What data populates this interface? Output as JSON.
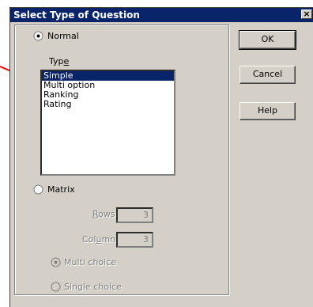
{
  "dialog": {
    "title": "Select Type of Question",
    "close_label": "×"
  },
  "normal": {
    "label": "Normal",
    "selected": true
  },
  "type": {
    "label_prefix": "Typ",
    "label_underline": "e",
    "items": [
      "Simple",
      "Multi option",
      "Ranking",
      "Rating"
    ],
    "selected": "Simple"
  },
  "matrix": {
    "label": "Matrix",
    "selected": false,
    "rows_label_underline": "R",
    "rows_label_rest": "ows",
    "rows_value": "3",
    "columns_label_prefix": "Col",
    "columns_label_underline": "u",
    "columns_label_rest": "mns",
    "columns_value": "3",
    "multi_choice_label": "Multi choice",
    "single_choice_label": "Single choice"
  },
  "buttons": {
    "ok": "OK",
    "cancel": "Cancel",
    "help": "Help"
  },
  "colors": {
    "titlebar": "#0a246a",
    "selection": "#0a246a",
    "dialog_bg": "#d4d0c8",
    "arrow": "#ff0000"
  }
}
